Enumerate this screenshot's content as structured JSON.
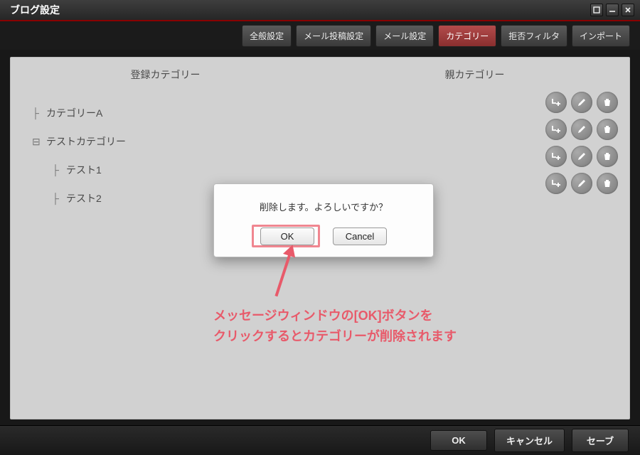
{
  "window": {
    "title": "ブログ設定"
  },
  "tabs": [
    {
      "label": "全般設定"
    },
    {
      "label": "メール投稿設定"
    },
    {
      "label": "メール設定"
    },
    {
      "label": "カテゴリー",
      "active": true
    },
    {
      "label": "拒否フィルタ"
    },
    {
      "label": "インポート"
    }
  ],
  "columns": {
    "registered": "登録カテゴリー",
    "parent": "親カテゴリー"
  },
  "tree": {
    "items": [
      {
        "label": "カテゴリーA"
      },
      {
        "label": "テストカテゴリー"
      },
      {
        "label": "テスト1"
      },
      {
        "label": "テスト2"
      }
    ]
  },
  "row_action_icons": {
    "add": "add-child-icon",
    "edit": "edit-icon",
    "delete": "trash-icon"
  },
  "dialog": {
    "message": "削除します。よろしいですか？",
    "ok": "OK",
    "cancel": "Cancel"
  },
  "annotation": {
    "line1": "メッセージウィンドウの[OK]ボタンを",
    "line2": "クリックするとカテゴリーが削除されます"
  },
  "footer": {
    "ok": "OK",
    "cancel": "キャンセル",
    "save": "セーブ"
  }
}
